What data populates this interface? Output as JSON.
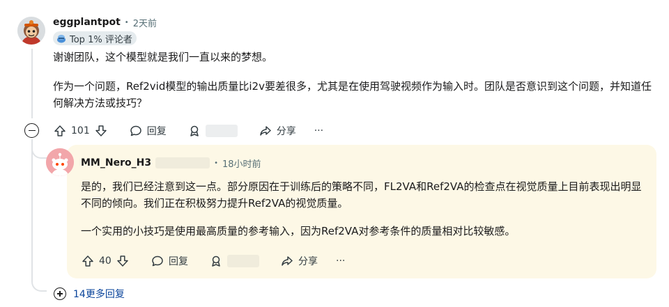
{
  "comment1": {
    "username": "eggplantpot",
    "time": "2天前",
    "flair": "Top 1% 评论者",
    "body": [
      "谢谢团队，这个模型就是我们一直以来的梦想。",
      "作为一个问题，Ref2vid模型的输出质量比i2v要差很多，尤其是在使用驾驶视频作为输入时。团队是否意识到这个问题，并知道任何解决方法或技巧？"
    ],
    "votes": "101",
    "reply_label": "回复",
    "share_label": "分享",
    "more_label": "···"
  },
  "comment2": {
    "username": "MM_Nero_H3",
    "time": "18小时前",
    "body": [
      "是的，我们已经注意到这一点。部分原因在于训练后的策略不同，FL2VA和Ref2VA的检查点在视觉质量上目前表现出明显不同的倾向。我们正在积极努力提升Ref2VA的视觉质量。",
      "一个实用的小技巧是使用最高质量的参考输入，因为Ref2VA对参考条件的质量相对比较敏感。"
    ],
    "votes": "40",
    "reply_label": "回复",
    "share_label": "分享",
    "more_label": "···"
  },
  "more_replies": "14更多回复",
  "colors": {
    "reply_bg": "#fdf8e6",
    "link": "#0a449b",
    "muted": "#576f76"
  }
}
